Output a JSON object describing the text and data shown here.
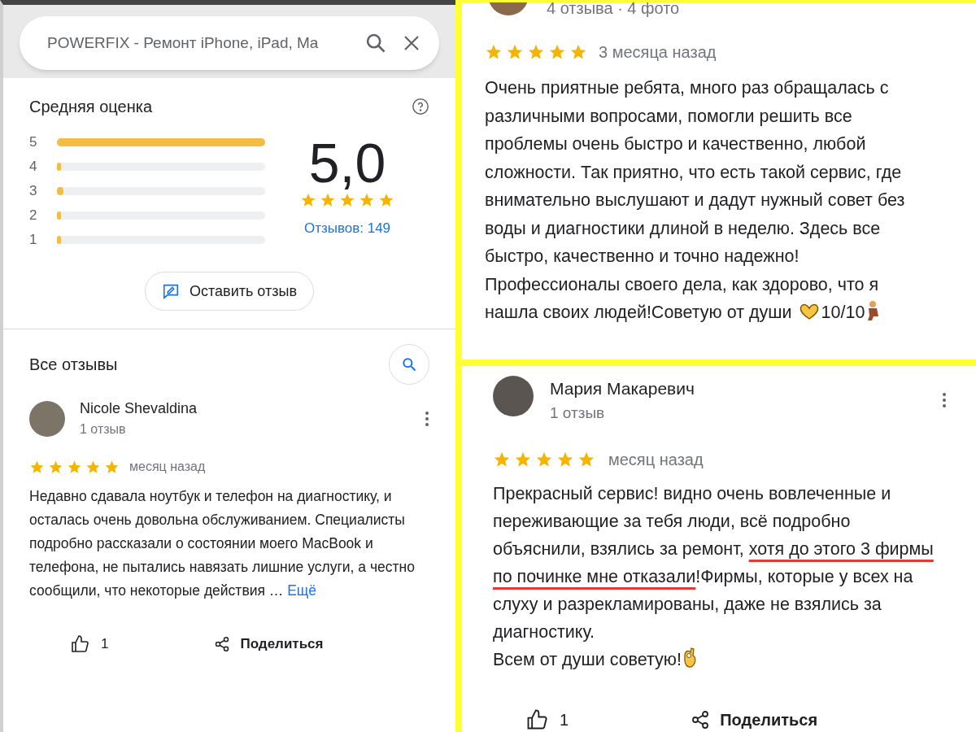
{
  "left_panel": {
    "search": {
      "value": "POWERFIX - Ремонт iPhone, iPad, Ma"
    },
    "summary": {
      "title": "Средняя оценка",
      "bars": [
        {
          "label": "5",
          "level": 1
        },
        {
          "label": "4",
          "level": 0.01
        },
        {
          "label": "3",
          "level": 0.03
        },
        {
          "label": "2",
          "level": 0.01
        },
        {
          "label": "1",
          "level": 0.01
        }
      ],
      "score": "5,0",
      "stars": 5,
      "count_link": "Отзывов: 149",
      "write_button": "Оставить отзыв"
    },
    "reviews_title": "Все отзывы",
    "review": {
      "author": "Nicole Shevaldina",
      "meta": "1 отзыв",
      "stars": 5,
      "time": "месяц назад",
      "body": [
        {
          "kind": "text",
          "text": "Недавно сдавала ноутбук и телефон на диагностику, и осталась очень довольна обслуживанием. Специалисты подробно рассказали о состоянии моего MacBook и телефона, не пытались навязать лишние услуги, а честно сообщили, что некоторые действия … "
        },
        {
          "kind": "link",
          "text": "Ещё"
        }
      ],
      "likes": "1",
      "share": "Поделиться"
    }
  },
  "right_top": {
    "meta": "4 отзыва · 4 фото",
    "stars": 5,
    "time": "3 месяца назад",
    "body": [
      {
        "kind": "text",
        "text": "Очень приятные ребята, много раз обращалась с различными вопросами, помогли решить все проблемы очень быстро и качественно, любой сложности. Так приятно, что есть такой сервис, где внимательно выслушают и дадут нужный совет без воды и диагностики длиной в неделю. Здесь все быстро, качественно и точно надежно! Профессионалы своего дела, как здорово, что я нашла своих людей!Советую от души "
      },
      {
        "kind": "hands-emoji"
      },
      {
        "kind": "text",
        "text": "10/10"
      },
      {
        "kind": "person-emoji"
      }
    ]
  },
  "right_bottom": {
    "author": "Мария Макаревич",
    "meta": "1 отзыв",
    "stars": 5,
    "time": "месяц назад",
    "body": [
      {
        "kind": "text",
        "text": "Прекрасный сервис! видно очень вовлеченные и переживающие за тебя люди, всё подробно объяснили, взялись за ремонт, "
      },
      {
        "kind": "marked",
        "text": "хотя до этого 3 фирмы по починке мне отказали"
      },
      {
        "kind": "text",
        "text": "!Фирмы, которые у всех на слуху и разрекламированы, даже не взялись за диагностику."
      },
      {
        "kind": "break"
      },
      {
        "kind": "text",
        "text": "Всем от души советую!"
      },
      {
        "kind": "ok-emoji"
      }
    ],
    "likes": "1",
    "share": "Поделиться"
  }
}
